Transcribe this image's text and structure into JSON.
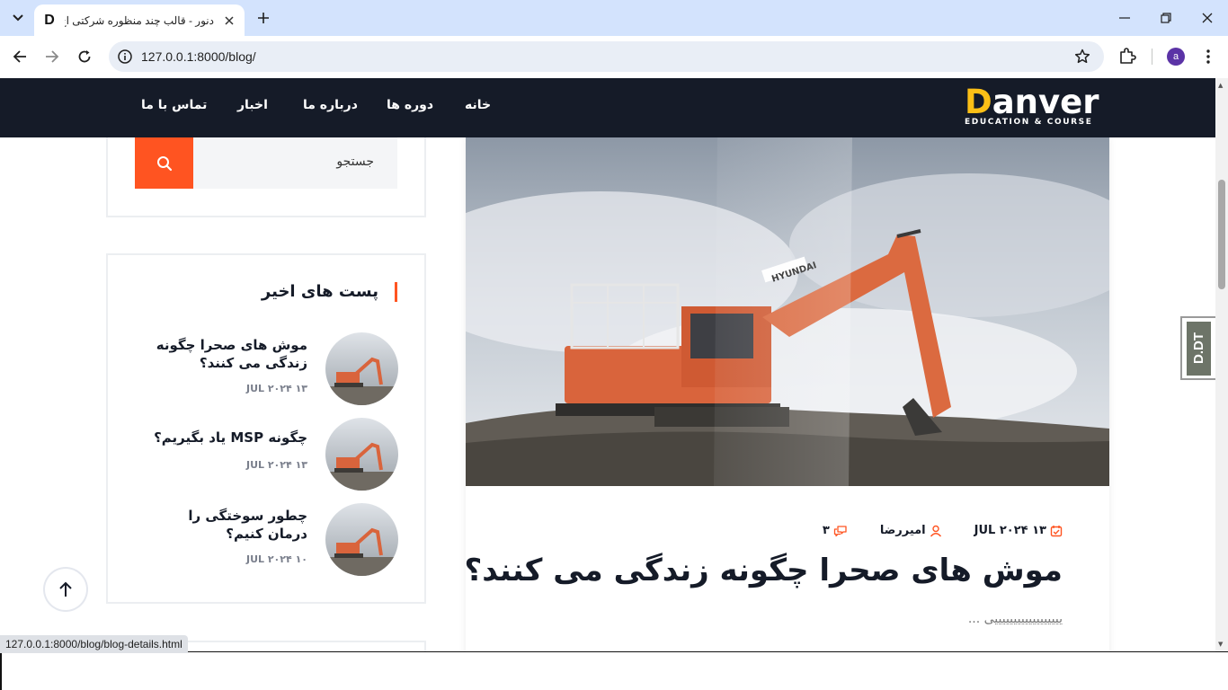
{
  "browser": {
    "tab_title": "دنور - قالب چند منظوره شرکتی اچ",
    "favicon_letter": "D",
    "url": "127.0.0.1:8000/blog/",
    "profile_initial": "a",
    "status_url": "127.0.0.1:8000/blog/blog-details.html"
  },
  "site": {
    "logo_first": "D",
    "logo_rest": "anver",
    "logo_tagline": "EDUCATION & COURSE",
    "nav": [
      "خانه",
      "دوره ها",
      "درباره ما",
      "اخبار",
      "تماس با ما"
    ],
    "accent_color": "#ff5421",
    "logo_color": "#fbbf16",
    "header_color": "#151b28"
  },
  "sidebar": {
    "search_placeholder": "جستجو",
    "recent_title": "پست های اخیر",
    "recent_posts": [
      {
        "title": "موش های صحرا چگونه زندگی می کنند؟",
        "date": "۱۳ JUL ۲۰۲۴"
      },
      {
        "title": "چگونه MSP یاد بگیریم؟",
        "date": "۱۳ JUL ۲۰۲۴"
      },
      {
        "title": "چطور سوختگی را درمان کنیم؟",
        "date": "۱۰ JUL ۲۰۲۴"
      }
    ]
  },
  "post": {
    "date": "۱۳ JUL ۲۰۲۴",
    "author": "امیررضا",
    "comments": "۳",
    "title": "موش های صحرا چگونه زندگی می کنند؟",
    "excerpt": "ییییییییییییییییییی ..."
  },
  "side_badge": "D.DT"
}
